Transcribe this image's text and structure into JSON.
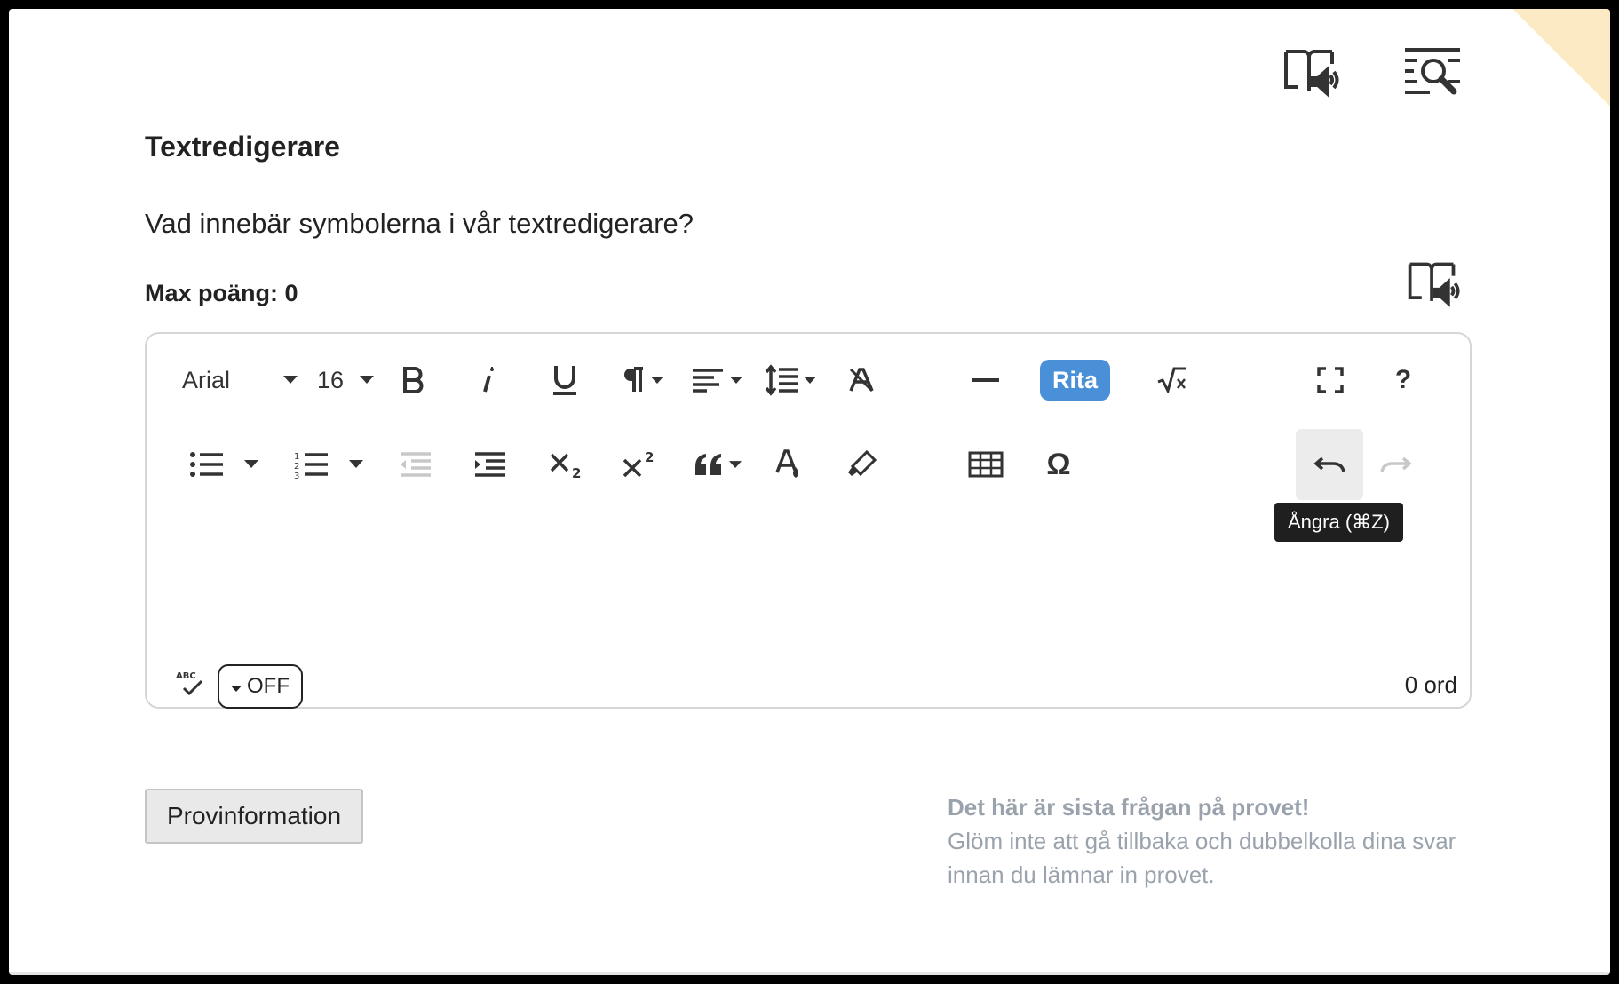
{
  "header": {
    "icons": [
      "book-speaker-icon",
      "search-lines-icon"
    ]
  },
  "question": {
    "title": "Textredigerare",
    "text": "Vad innebär symbolerna i vår textredigerare?",
    "max_points": "Max poäng: 0"
  },
  "editor": {
    "font_family": "Arial",
    "font_size": "16",
    "draw_label": "Rita",
    "help_label": "?",
    "undo_tooltip": "Ångra (⌘Z)",
    "spellcheck_label": "ABC",
    "spellcheck_state": "OFF",
    "word_count": "0 ord",
    "accent_color": "#4a90d9"
  },
  "footer": {
    "info_button": "Provinformation",
    "notice_title": "Det här är sista frågan på provet!",
    "notice_text": "Glöm inte att gå tillbaka och dubbelkolla dina svar innan du lämnar in provet."
  }
}
